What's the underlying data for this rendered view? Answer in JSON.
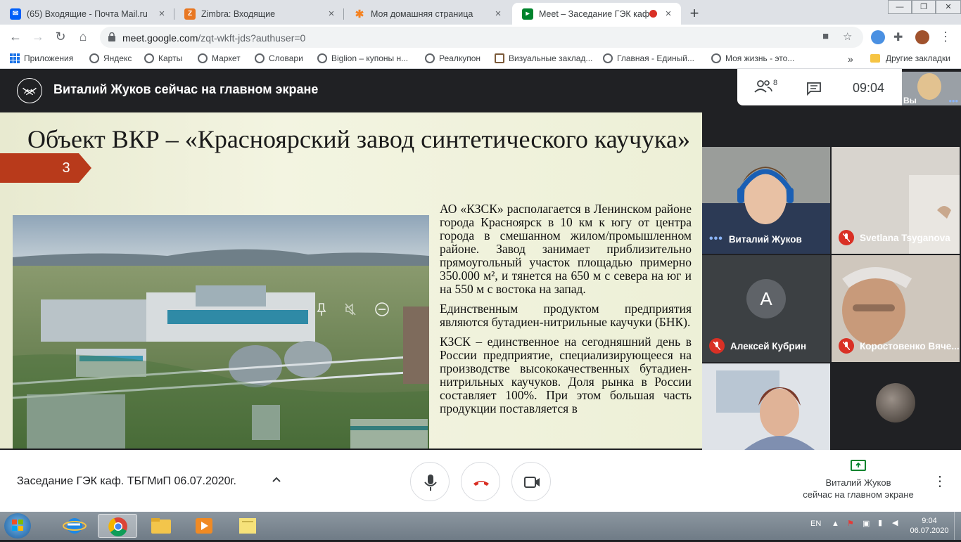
{
  "browser": {
    "tabs": [
      {
        "title": "(65) Входящие - Почта Mail.ru",
        "icon": "mail-envelope-icon",
        "color": "#005ff9"
      },
      {
        "title": "Zimbra: Входящие",
        "icon": "zimbra-icon",
        "color": "#e87722"
      },
      {
        "title": "Моя домашняя страница",
        "icon": "flower-icon",
        "color": "#f58220"
      },
      {
        "title": "Meet – Заседание ГЭК каф.",
        "icon": "meet-icon",
        "color": "#00832d",
        "active": true
      }
    ],
    "new_tab": "+",
    "url_host": "meet.google.com",
    "url_path": "/zqt-wkft-jds?authuser=0"
  },
  "bookmarks": {
    "apps": "Приложения",
    "items": [
      "Яндекс",
      "Карты",
      "Маркет",
      "Словари",
      "Biglion – купоны н...",
      "Реалкупон",
      "Визуальные заклад...",
      "Главная - Единый...",
      "Моя жизнь - это..."
    ],
    "overflow": "»",
    "other": "Другие закладки"
  },
  "meet": {
    "presenting_banner": "Виталий Жуков сейчас на главном экране",
    "participant_count": "8",
    "clock": "09:04",
    "self_label": "Вы",
    "slide": {
      "title": "Объект ВКР – «Красноярский завод синтетического каучука»",
      "number": "3",
      "paragraphs": [
        "АО «КЗСК» располагается в Ленинском районе города Красноярск в 10 км к югу от центра города в смешанном жилом/промышленном районе. Завод занимает приблизительно прямоугольный участок площадью примерно 350.000 м², и тянется на 650 м с севера на юг и на 550 м с востока на запад.",
        "Единственным продуктом предприятия являются бутадиен-нитрильные каучуки (БНК).",
        "КЗСК – единственное на сегодняшний день в России предприятие, специализирующееся на производстве высококачественных бутадиен-нитрильных каучуков. Доля рынка в России составляет 100%. При этом большая часть продукции поставляется в"
      ]
    },
    "participants": [
      {
        "name": "Виталий Жуков",
        "muted": false,
        "speaking": true
      },
      {
        "name": "Svetlana Tsyganova",
        "muted": true
      },
      {
        "name": "Алексей Кубрин",
        "muted": true,
        "avatar_letter": "A"
      },
      {
        "name": "Коростовенко Вяче...",
        "muted": true
      },
      {
        "name": "",
        "muted": true
      },
      {
        "name": "",
        "muted": true
      }
    ],
    "meeting_title": "Заседание ГЭК каф. ТБГМиП 06.07.2020г.",
    "presenter_line1": "Виталий Жуков",
    "presenter_line2": "сейчас на главном экране",
    "colors": {
      "hangup": "#d93025",
      "accent": "#00832d",
      "muted": "#d93025"
    }
  },
  "taskbar": {
    "lang": "EN",
    "time": "9:04",
    "date": "06.07.2020"
  }
}
